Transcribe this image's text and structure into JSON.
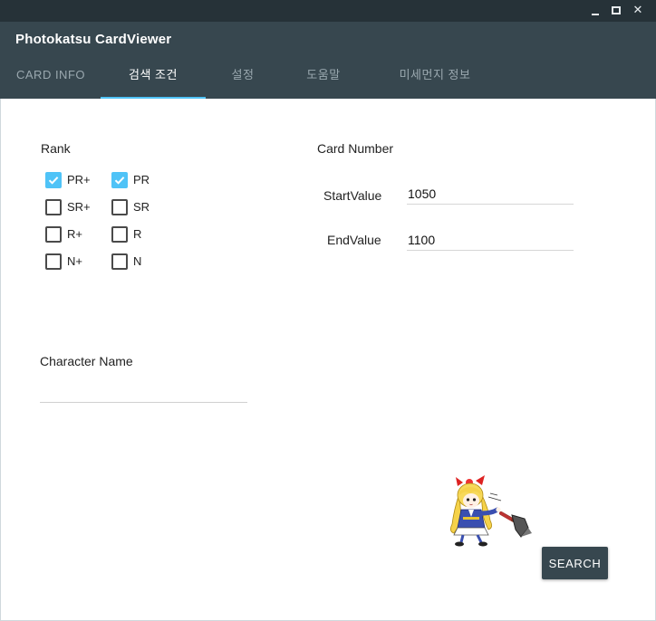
{
  "window": {
    "minimize_icon": "minimize-icon",
    "maximize_icon": "maximize-icon",
    "close_icon": "close-icon",
    "close_glyph": "✕"
  },
  "app": {
    "title": "Photokatsu CardViewer"
  },
  "tabs": [
    {
      "label": "CARD INFO",
      "active": false
    },
    {
      "label": "검색 조건",
      "active": true
    },
    {
      "label": "설정",
      "active": false
    },
    {
      "label": "도움말",
      "active": false
    },
    {
      "label": "미세먼지 정보",
      "active": false
    }
  ],
  "rank": {
    "label": "Rank",
    "options": [
      {
        "label": "PR+",
        "checked": true
      },
      {
        "label": "PR",
        "checked": true
      },
      {
        "label": "SR+",
        "checked": false
      },
      {
        "label": "SR",
        "checked": false
      },
      {
        "label": "R+",
        "checked": false
      },
      {
        "label": "R",
        "checked": false
      },
      {
        "label": "N+",
        "checked": false
      },
      {
        "label": "N",
        "checked": false
      }
    ]
  },
  "card_number": {
    "label": "Card Number",
    "start_label": "StartValue",
    "start_value": "1050",
    "end_label": "EndValue",
    "end_value": "1100"
  },
  "character": {
    "label": "Character Name",
    "value": ""
  },
  "search_button": "SEARCH",
  "colors": {
    "title_bar": "#263238",
    "app_bar": "#37474f",
    "accent": "#4fc3f7",
    "button": "#37474f"
  }
}
